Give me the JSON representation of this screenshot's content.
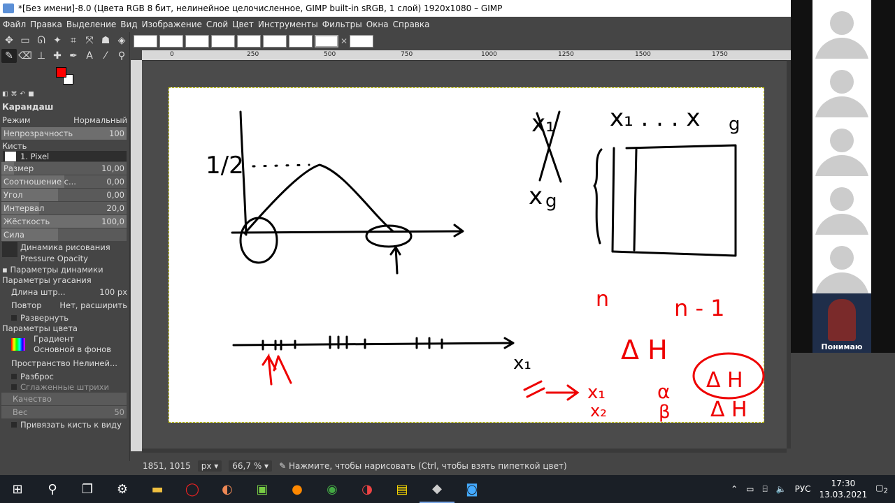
{
  "titlebar": {
    "title": "*[Без имени]-8.0 (Цвета RGB 8 бит, нелинейное целочисленное, GIMP built-in sRGB, 1 слой) 1920x1080 – GIMP"
  },
  "menu": [
    "Файл",
    "Правка",
    "Выделение",
    "Вид",
    "Изображение",
    "Слой",
    "Цвет",
    "Инструменты",
    "Фильтры",
    "Окна",
    "Справка"
  ],
  "tool_options": {
    "title": "Карандаш",
    "mode_label": "Режим",
    "mode_value": "Нормальный",
    "opacity_label": "Непрозрачность",
    "opacity_value": "100",
    "brush_label": "Кисть",
    "brush_value": "1. Pixel",
    "size_label": "Размер",
    "size_value": "10,00",
    "aspect_label": "Соотношение с...",
    "aspect_value": "0,00",
    "angle_label": "Угол",
    "angle_value": "0,00",
    "spacing_label": "Интервал",
    "spacing_value": "20,0",
    "hardness_label": "Жёсткость",
    "hardness_value": "100,0",
    "force_label": "Сила",
    "dynamics_label": "Динамика рисования",
    "dynamics_value": "Pressure Opacity",
    "dyn_params": "Параметры динамики",
    "fade_params": "Параметры угасания",
    "stroke_len_label": "Длина штр...",
    "stroke_len_value": "100",
    "stroke_unit": "px",
    "repeat_label": "Повтор",
    "repeat_value": "Нет, расширить",
    "reverse_label": "Развернуть",
    "color_params": "Параметры цвета",
    "gradient_label": "Градиент",
    "gradient_value": "Основной в фонов",
    "space_label": "Пространство Нелиней...",
    "jitter_label": "Разброс",
    "smooth_label": "Сглаженные штрихи",
    "quality_label": "Качество",
    "weight_label": "Вес",
    "weight_value": "50",
    "lock_brush_label": "Привязать кисть к виду"
  },
  "ruler": {
    "ticks": [
      "0",
      "250",
      "500",
      "750",
      "1000",
      "1250",
      "1500",
      "1750"
    ]
  },
  "status": {
    "coords": "1851, 1015",
    "unit": "px",
    "zoom": "66,7 %",
    "hint": "Нажмите, чтобы нарисовать (Ctrl, чтобы взять пипеткой цвет)"
  },
  "drawing": {
    "t_half": "1/2",
    "t_x1_top": "x₁ . . . x",
    "t_g_top": "g",
    "t_x1": "x₁",
    "t_xg_left": "x",
    "t_g_left": "g",
    "t_n": "n",
    "t_n1": "n - 1",
    "t_dh": "Δ H",
    "t_dh_circle": "Δ H",
    "t_x1_red": "x₁",
    "t_x2_red": "x₂",
    "t_alpha": "α",
    "t_beta": "β",
    "t_dh2": "Δ H"
  },
  "video": {
    "speaker_label": "Понимаю"
  },
  "taskbar": {
    "lang": "РУС",
    "time": "17:30",
    "date": "13.03.2021",
    "notif": "2"
  }
}
